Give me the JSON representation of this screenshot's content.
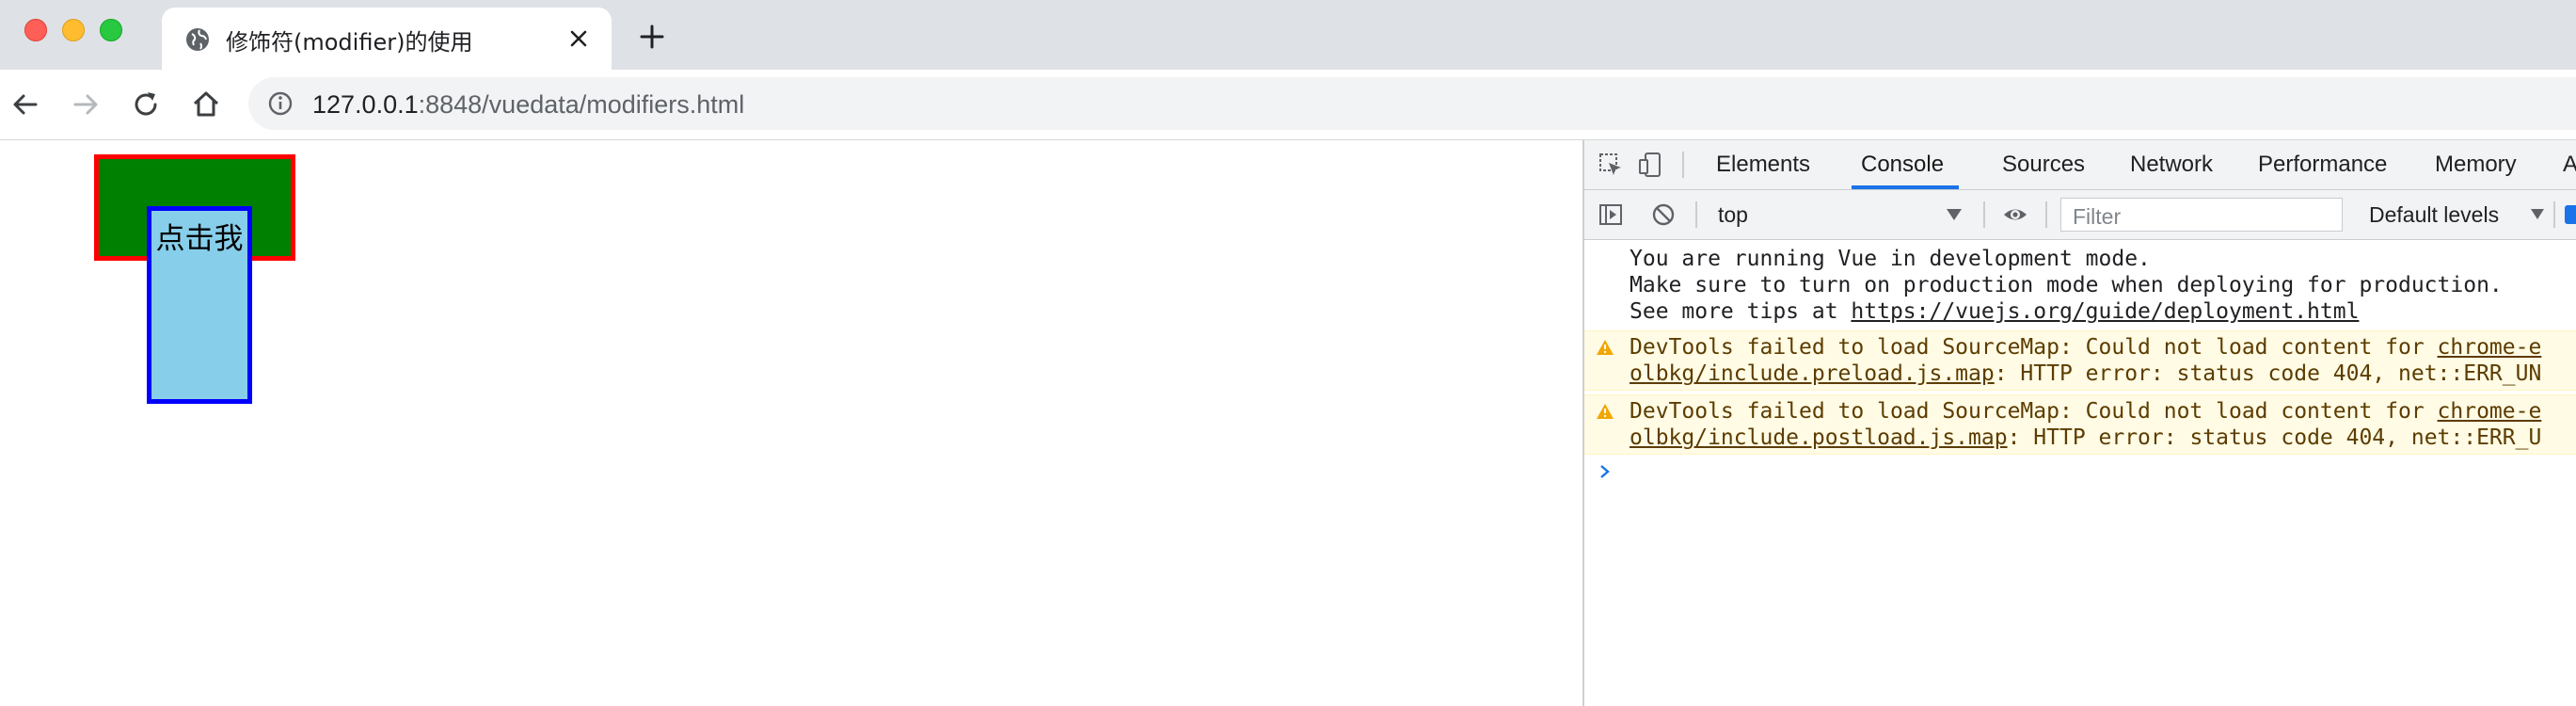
{
  "window": {
    "tab_title": "修饰符(modifier)的使用",
    "url_host": "127.0.0.1",
    "url_rest": ":8848/vuedata/modifiers.html"
  },
  "page": {
    "inner_box_label": "点击我"
  },
  "devtools": {
    "tabs": [
      "Elements",
      "Console",
      "Sources",
      "Network",
      "Performance",
      "Memory",
      "A"
    ],
    "active_tab": "Console",
    "context": "top",
    "filter_placeholder": "Filter",
    "levels": "Default levels",
    "messages": {
      "info_line1": "You are running Vue in development mode.",
      "info_line2": "Make sure to turn on production mode when deploying for production.",
      "info_line3_prefix": "See more tips at ",
      "info_line3_link": "https://vuejs.org/guide/deployment.html",
      "warn1_prefix": "DevTools failed to load SourceMap: Could not load content for ",
      "warn1_link_a": "chrome-e",
      "warn1_link_b": "olbkg/include.preload.js.map",
      "warn1_suffix": ": HTTP error: status code 404, net::ERR_UN",
      "warn2_prefix": "DevTools failed to load SourceMap: Could not load content for ",
      "warn2_link_a": "chrome-e",
      "warn2_link_b": "olbkg/include.postload.js.map",
      "warn2_suffix": ": HTTP error: status code 404, net::ERR_U"
    }
  },
  "colors": {
    "outer_fill": "#008000",
    "outer_border": "#ff0000",
    "inner_fill": "#87ceeb",
    "inner_border": "#0000ff",
    "accent": "#1a73e8"
  },
  "icons": [
    "globe-icon",
    "close-icon",
    "plus-icon",
    "back-arrow-icon",
    "forward-arrow-icon",
    "reload-icon",
    "home-icon",
    "info-icon",
    "inspect-icon",
    "device-toolbar-icon",
    "sidebar-toggle-icon",
    "clear-console-icon",
    "eye-icon",
    "warning-icon",
    "prompt-chevron-icon"
  ]
}
